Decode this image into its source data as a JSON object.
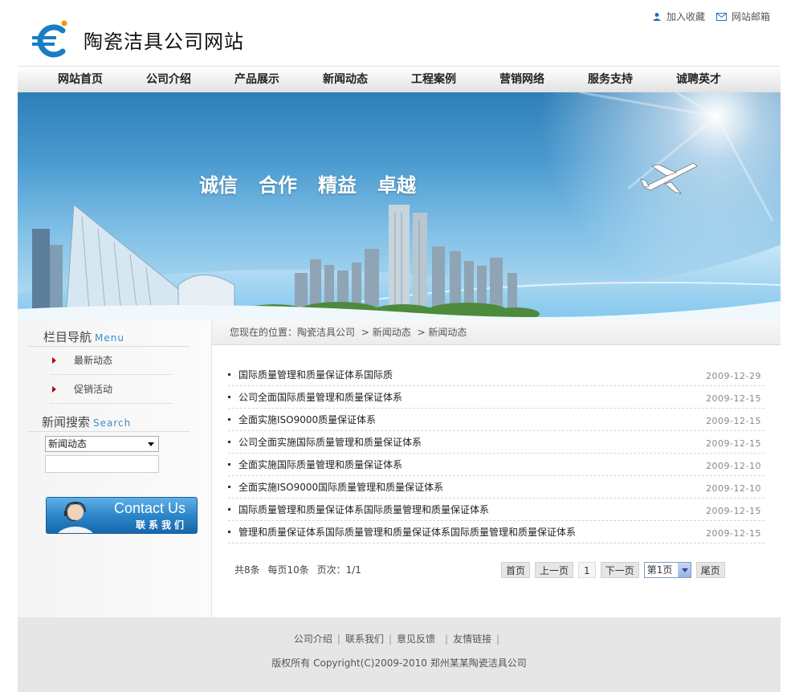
{
  "header": {
    "site_title": "陶瓷洁具公司网站",
    "top_links": [
      {
        "label": "加入收藏",
        "icon": "user-icon"
      },
      {
        "label": "网站邮箱",
        "icon": "mail-icon"
      }
    ]
  },
  "nav": {
    "items": [
      "网站首页",
      "公司介绍",
      "产品展示",
      "新闻动态",
      "工程案例",
      "营销网络",
      "服务支持",
      "诚聘英才"
    ]
  },
  "banner": {
    "slogan": [
      "诚信",
      "合作",
      "精益",
      "卓越"
    ]
  },
  "sidebar": {
    "menu_title": "栏目导航",
    "menu_title_en": "Menu",
    "menu_items": [
      "最新动态",
      "促销活动"
    ],
    "search_title": "新闻搜索",
    "search_title_en": "Search",
    "search_select_value": "新闻动态",
    "search_input_value": "",
    "contact_en": "Contact Us",
    "contact_cn": "联系我们"
  },
  "breadcrumb": {
    "prefix": "您现在的位置：",
    "items": [
      "陶瓷洁具公司",
      "> 新闻动态",
      "> 新闻动态"
    ]
  },
  "news": [
    {
      "title": "国际质量管理和质量保证体系国际质",
      "date": "2009-12-29"
    },
    {
      "title": "公司全面国际质量管理和质量保证体系",
      "date": "2009-12-15"
    },
    {
      "title": "全面实施ISO9000质量保证体系",
      "date": "2009-12-15"
    },
    {
      "title": "公司全面实施国际质量管理和质量保证体系",
      "date": "2009-12-15"
    },
    {
      "title": "全面实施国际质量管理和质量保证体系",
      "date": "2009-12-10"
    },
    {
      "title": "全面实施ISO9000国际质量管理和质量保证体系",
      "date": "2009-12-10"
    },
    {
      "title": "国际质量管理和质量保证体系国际质量管理和质量保证体系",
      "date": "2009-12-15"
    },
    {
      "title": "管理和质量保证体系国际质量管理和质量保证体系国际质量管理和质量保证体系",
      "date": "2009-12-15"
    }
  ],
  "pager": {
    "total": "共8条",
    "per_page": "每页10条",
    "pages": "页次：1/1",
    "first": "首页",
    "prev": "上一页",
    "current": "1",
    "next": "下一页",
    "select_value": "第1页",
    "last": "尾页"
  },
  "footer": {
    "links": [
      "公司介绍",
      "联系我们",
      "意见反馈",
      "友情链接"
    ],
    "copyright": "版权所有  Copyright(C)2009-2010 郑州某某陶瓷洁具公司"
  },
  "colors": {
    "accent_blue": "#3a8fc6",
    "arrow_red": "#b40000",
    "logo_orange": "#f29500"
  }
}
